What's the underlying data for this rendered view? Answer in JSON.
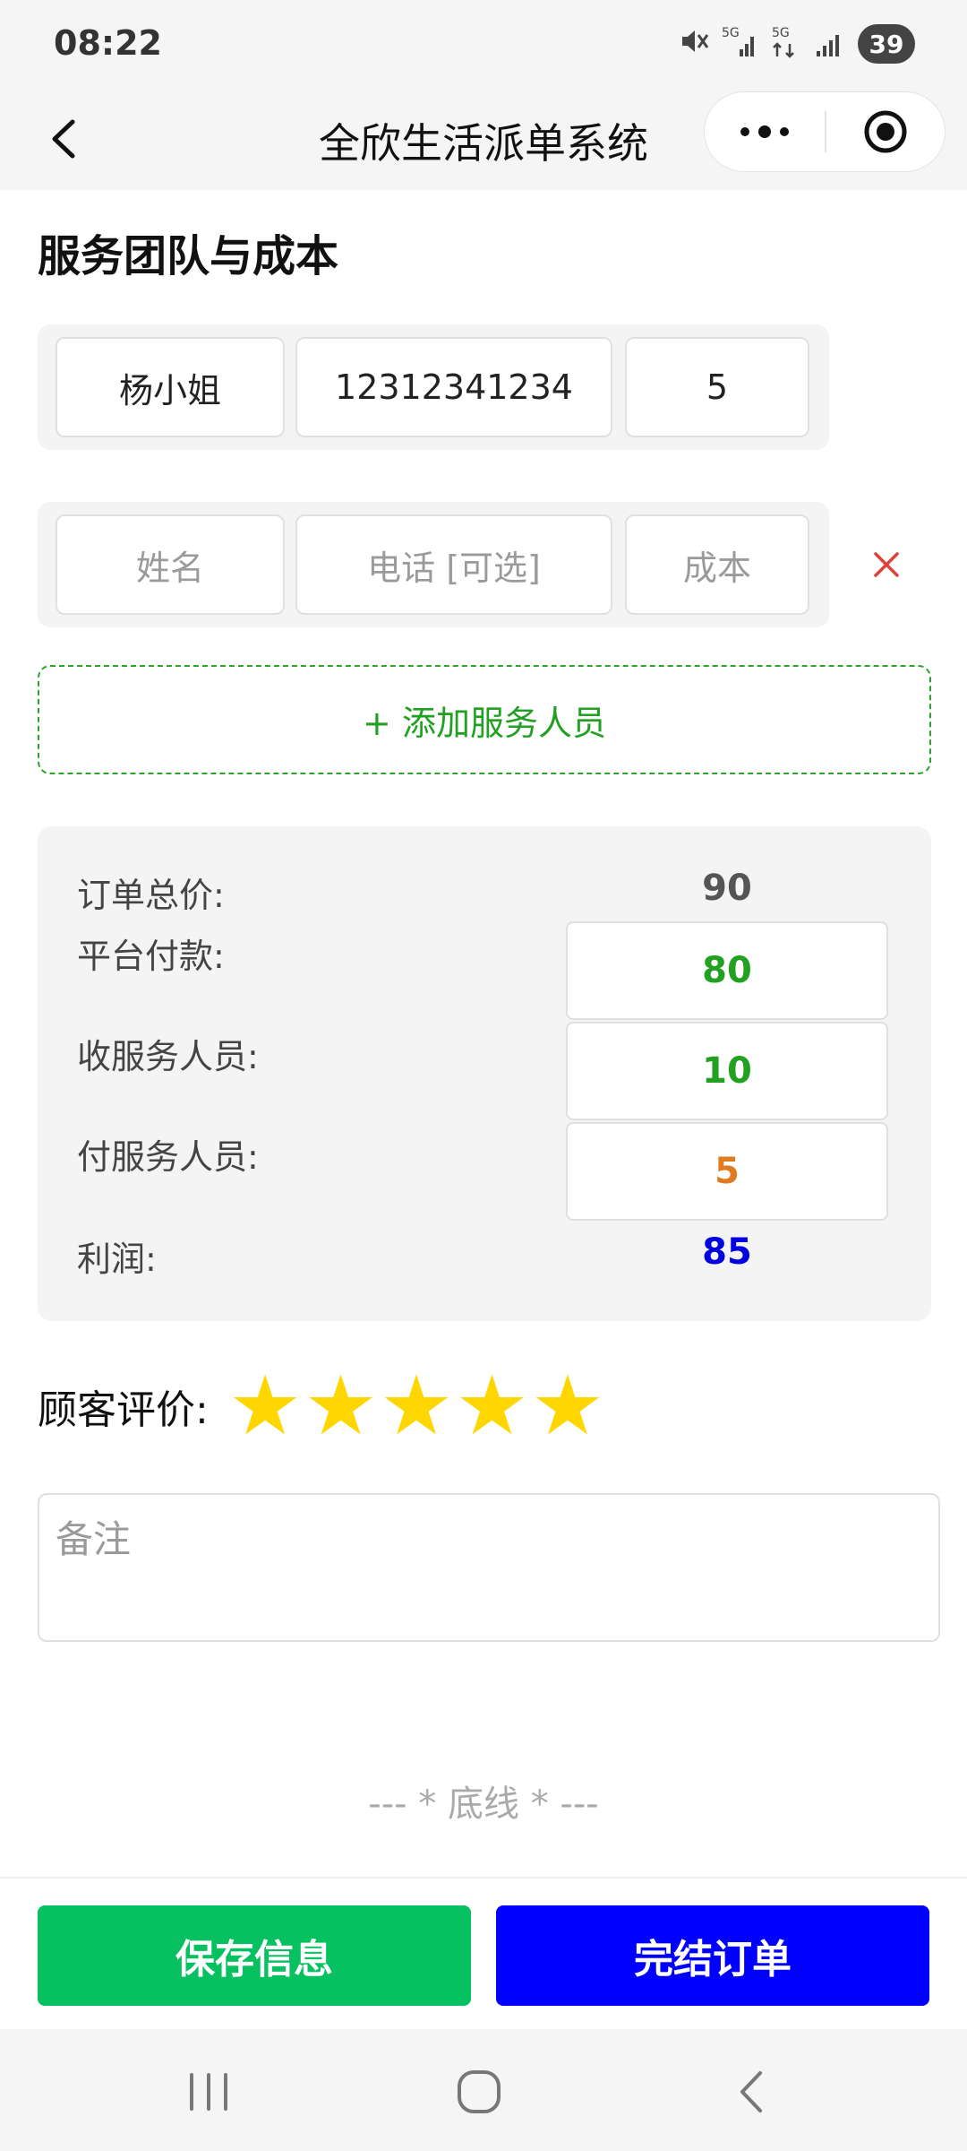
{
  "status_bar": {
    "time": "08:22",
    "battery": "39",
    "icons": [
      "mute-icon",
      "5g-signal-icon",
      "5g-data-icon",
      "signal-icon"
    ]
  },
  "nav": {
    "title": "全欣生活派单系统"
  },
  "section": {
    "title": "服务团队与成本"
  },
  "members": [
    {
      "name": "杨小姐",
      "phone": "12312341234",
      "cost": "5"
    }
  ],
  "new_member": {
    "name_placeholder": "姓名",
    "phone_placeholder": "电话 [可选]",
    "cost_placeholder": "成本"
  },
  "add_member_label": "+ 添加服务人员",
  "summary": {
    "order_total_label": "订单总价:",
    "order_total_value": "90",
    "platform_pay_label": "平台付款:",
    "platform_pay_value": "80",
    "receive_staff_label": "收服务人员:",
    "receive_staff_value": "10",
    "pay_staff_label": "付服务人员:",
    "pay_staff_value": "5",
    "profit_label": "利润:",
    "profit_value": "85"
  },
  "rating": {
    "label": "顾客评价:",
    "stars": 5,
    "max": 5
  },
  "remark": {
    "placeholder": "备注"
  },
  "baseline_text": "--- * 底线 * ---",
  "buttons": {
    "save": "保存信息",
    "finish": "完结订单"
  },
  "colors": {
    "green": "#07c160",
    "blue": "#0000ff",
    "platform_value": "#22a022",
    "pay_staff_value": "#e07c20",
    "profit_value": "#0000e0",
    "star": "#ffd600"
  }
}
